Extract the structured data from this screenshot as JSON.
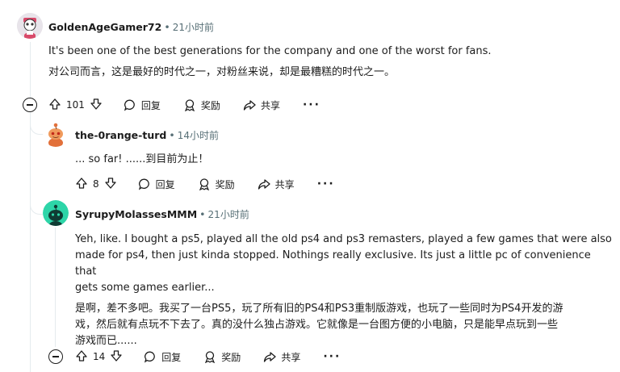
{
  "comments": [
    {
      "username": "GoldenAgeGamer72",
      "time": "21小时前",
      "body_en": "It's been one of the best generations for the company and one of the worst for fans.",
      "body_zh": "对公司而言，这是最好的时代之一，对粉丝来说，却是最糟糕的时代之一。",
      "votes": "101",
      "reply_label": "回复",
      "award_label": "奖励",
      "share_label": "共享"
    },
    {
      "username": "the-0range-turd",
      "time": "14小时前",
      "body_line": "... so far! ......到目前为止！",
      "votes": "8",
      "reply_label": "回复",
      "award_label": "奖励",
      "share_label": "共享"
    },
    {
      "username": "SyrupyMolassesMMM",
      "time": "21小时前",
      "body_en_lines": [
        "Yeh, like. I bought a ps5, played all the old ps4 and ps3 remasters, played a few games that were also",
        "made for ps4, then just kinda stopped. Nothings really exclusive. Its just a little pc of convenience that",
        "gets some games earlier..."
      ],
      "body_zh_lines": [
        "是啊，差不多吧。我买了一台PS5，玩了所有旧的PS4和PS3重制版游戏，也玩了一些同时为PS4开发的游",
        "戏，然后就有点玩不下去了。真的没什么独占游戏。它就像是一台图方便的小电脑，只是能早点玩到一些",
        "游戏而已......"
      ],
      "votes": "14",
      "reply_label": "回复",
      "award_label": "奖励",
      "share_label": "共享"
    }
  ],
  "colors": {
    "text": "#1c1c1c",
    "meta": "#576f76",
    "thread": "#e5ebee"
  },
  "icons": [
    "collapse-icon",
    "upvote-icon",
    "downvote-icon",
    "reply-icon",
    "award-icon",
    "share-icon",
    "more-icon"
  ]
}
